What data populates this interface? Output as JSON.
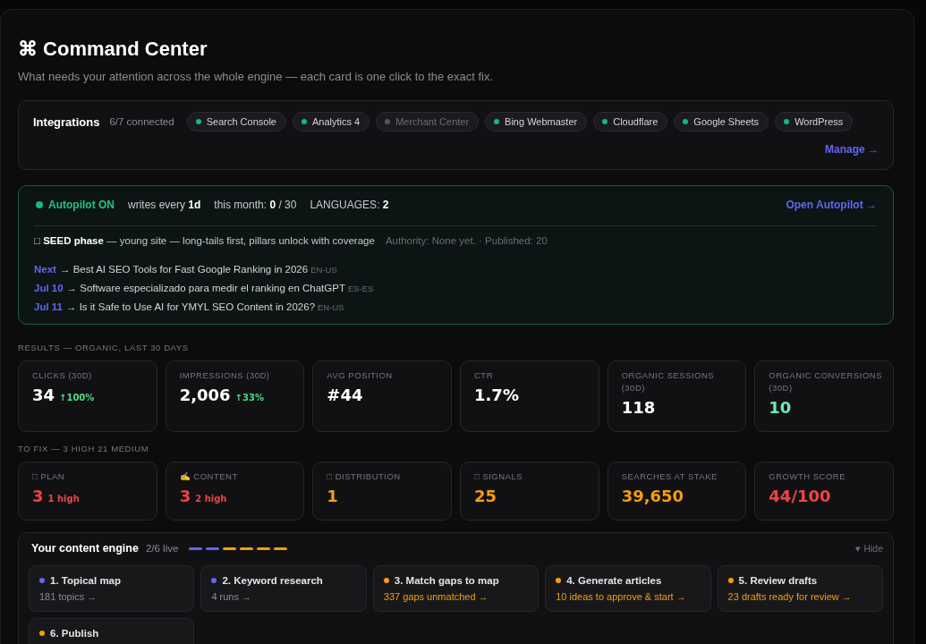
{
  "page": {
    "title": "⌘ Command Center",
    "subtitle": "What needs your attention across the whole engine — each card is one click to the exact fix."
  },
  "integrations": {
    "title": "Integrations",
    "count": "6/7 connected",
    "items": [
      {
        "name": "Search Console",
        "connected": true
      },
      {
        "name": "Analytics 4",
        "connected": true
      },
      {
        "name": "Merchant Center",
        "connected": false
      },
      {
        "name": "Bing Webmaster",
        "connected": true
      },
      {
        "name": "Cloudflare",
        "connected": true
      },
      {
        "name": "Google Sheets",
        "connected": true
      },
      {
        "name": "WordPress",
        "connected": true
      }
    ],
    "manage_link": "Manage →"
  },
  "autopilot": {
    "status": "Autopilot ON",
    "on": true,
    "stats": [
      "writes every **1d**",
      "this month: **0** / 30",
      "LANGUAGES: **2**"
    ],
    "open_link": "Open Autopilot →",
    "phase": "□ **SEED phase** — young site — long-tails first, pillars unlock with coverage",
    "phase_meta": "Authority: None yet. · Published: 20",
    "queue": [
      {
        "date": "Next",
        "title": "→ Best AI SEO Tools for Fast Google Ranking in 2026",
        "locale": "EN-US"
      },
      {
        "date": "Jul 10",
        "title": "→ Software especializado para medir el ranking en ChatGPT",
        "locale": "ES-ES"
      },
      {
        "date": "Jul 11",
        "title": "→ Is it Safe to Use AI for YMYL SEO Content in 2026?",
        "locale": "EN-US"
      }
    ]
  },
  "results": {
    "label": "RESULTS — ORGANIC, LAST 30 DAYS",
    "cards": [
      {
        "label": "CLICKS (30D)",
        "value": "34",
        "delta": "↑100%",
        "color": "#ffffff"
      },
      {
        "label": "IMPRESSIONS (30D)",
        "value": "2,006",
        "delta": "↑33%",
        "color": "#ffffff"
      },
      {
        "label": "AVG POSITION",
        "value": "#44",
        "color": "#ffffff"
      },
      {
        "label": "CTR",
        "value": "1.7%",
        "color": "#ffffff"
      },
      {
        "label": "ORGANIC SESSIONS (30D)",
        "value": "118",
        "color": "#ffffff"
      },
      {
        "label": "ORGANIC CONVERSIONS (30D)",
        "value": "10",
        "color": "#6ee7b7"
      }
    ]
  },
  "to_fix": {
    "label": "TO FIX — 3 HIGH 21 MEDIUM",
    "cards": [
      {
        "label": "□ PLAN",
        "value": "3",
        "note": "1 high",
        "color": "#ef4444"
      },
      {
        "label": "✍ CONTENT",
        "value": "3",
        "note": "2 high",
        "color": "#ef4444"
      },
      {
        "label": "□ DISTRIBUTION",
        "value": "1",
        "color": "#f59e0b"
      },
      {
        "label": "□ SIGNALS",
        "value": "25",
        "color": "#f59e0b"
      },
      {
        "label": "SEARCHES AT STAKE",
        "value": "39,650",
        "color": "#f59e0b"
      },
      {
        "label": "GROWTH SCORE",
        "value": "44/100",
        "color": "#ef4444"
      }
    ]
  },
  "engine": {
    "title": "Your content engine",
    "live_count": "2/6 live",
    "hide_label": "▾ Hide",
    "steps": [
      {
        "title": "1. Topical map",
        "detail": "181 topics →",
        "live": true
      },
      {
        "title": "2. Keyword research",
        "detail": "4 runs →",
        "live": true
      },
      {
        "title": "3. Match gaps to map",
        "detail": "337 gaps unmatched →",
        "live": false
      },
      {
        "title": "4. Generate articles",
        "detail": "10 ideas to approve & start →",
        "live": false
      },
      {
        "title": "5. Review drafts",
        "detail": "23 drafts ready for review →",
        "live": false
      },
      {
        "title": "6. Publish",
        "live": false
      }
    ]
  }
}
